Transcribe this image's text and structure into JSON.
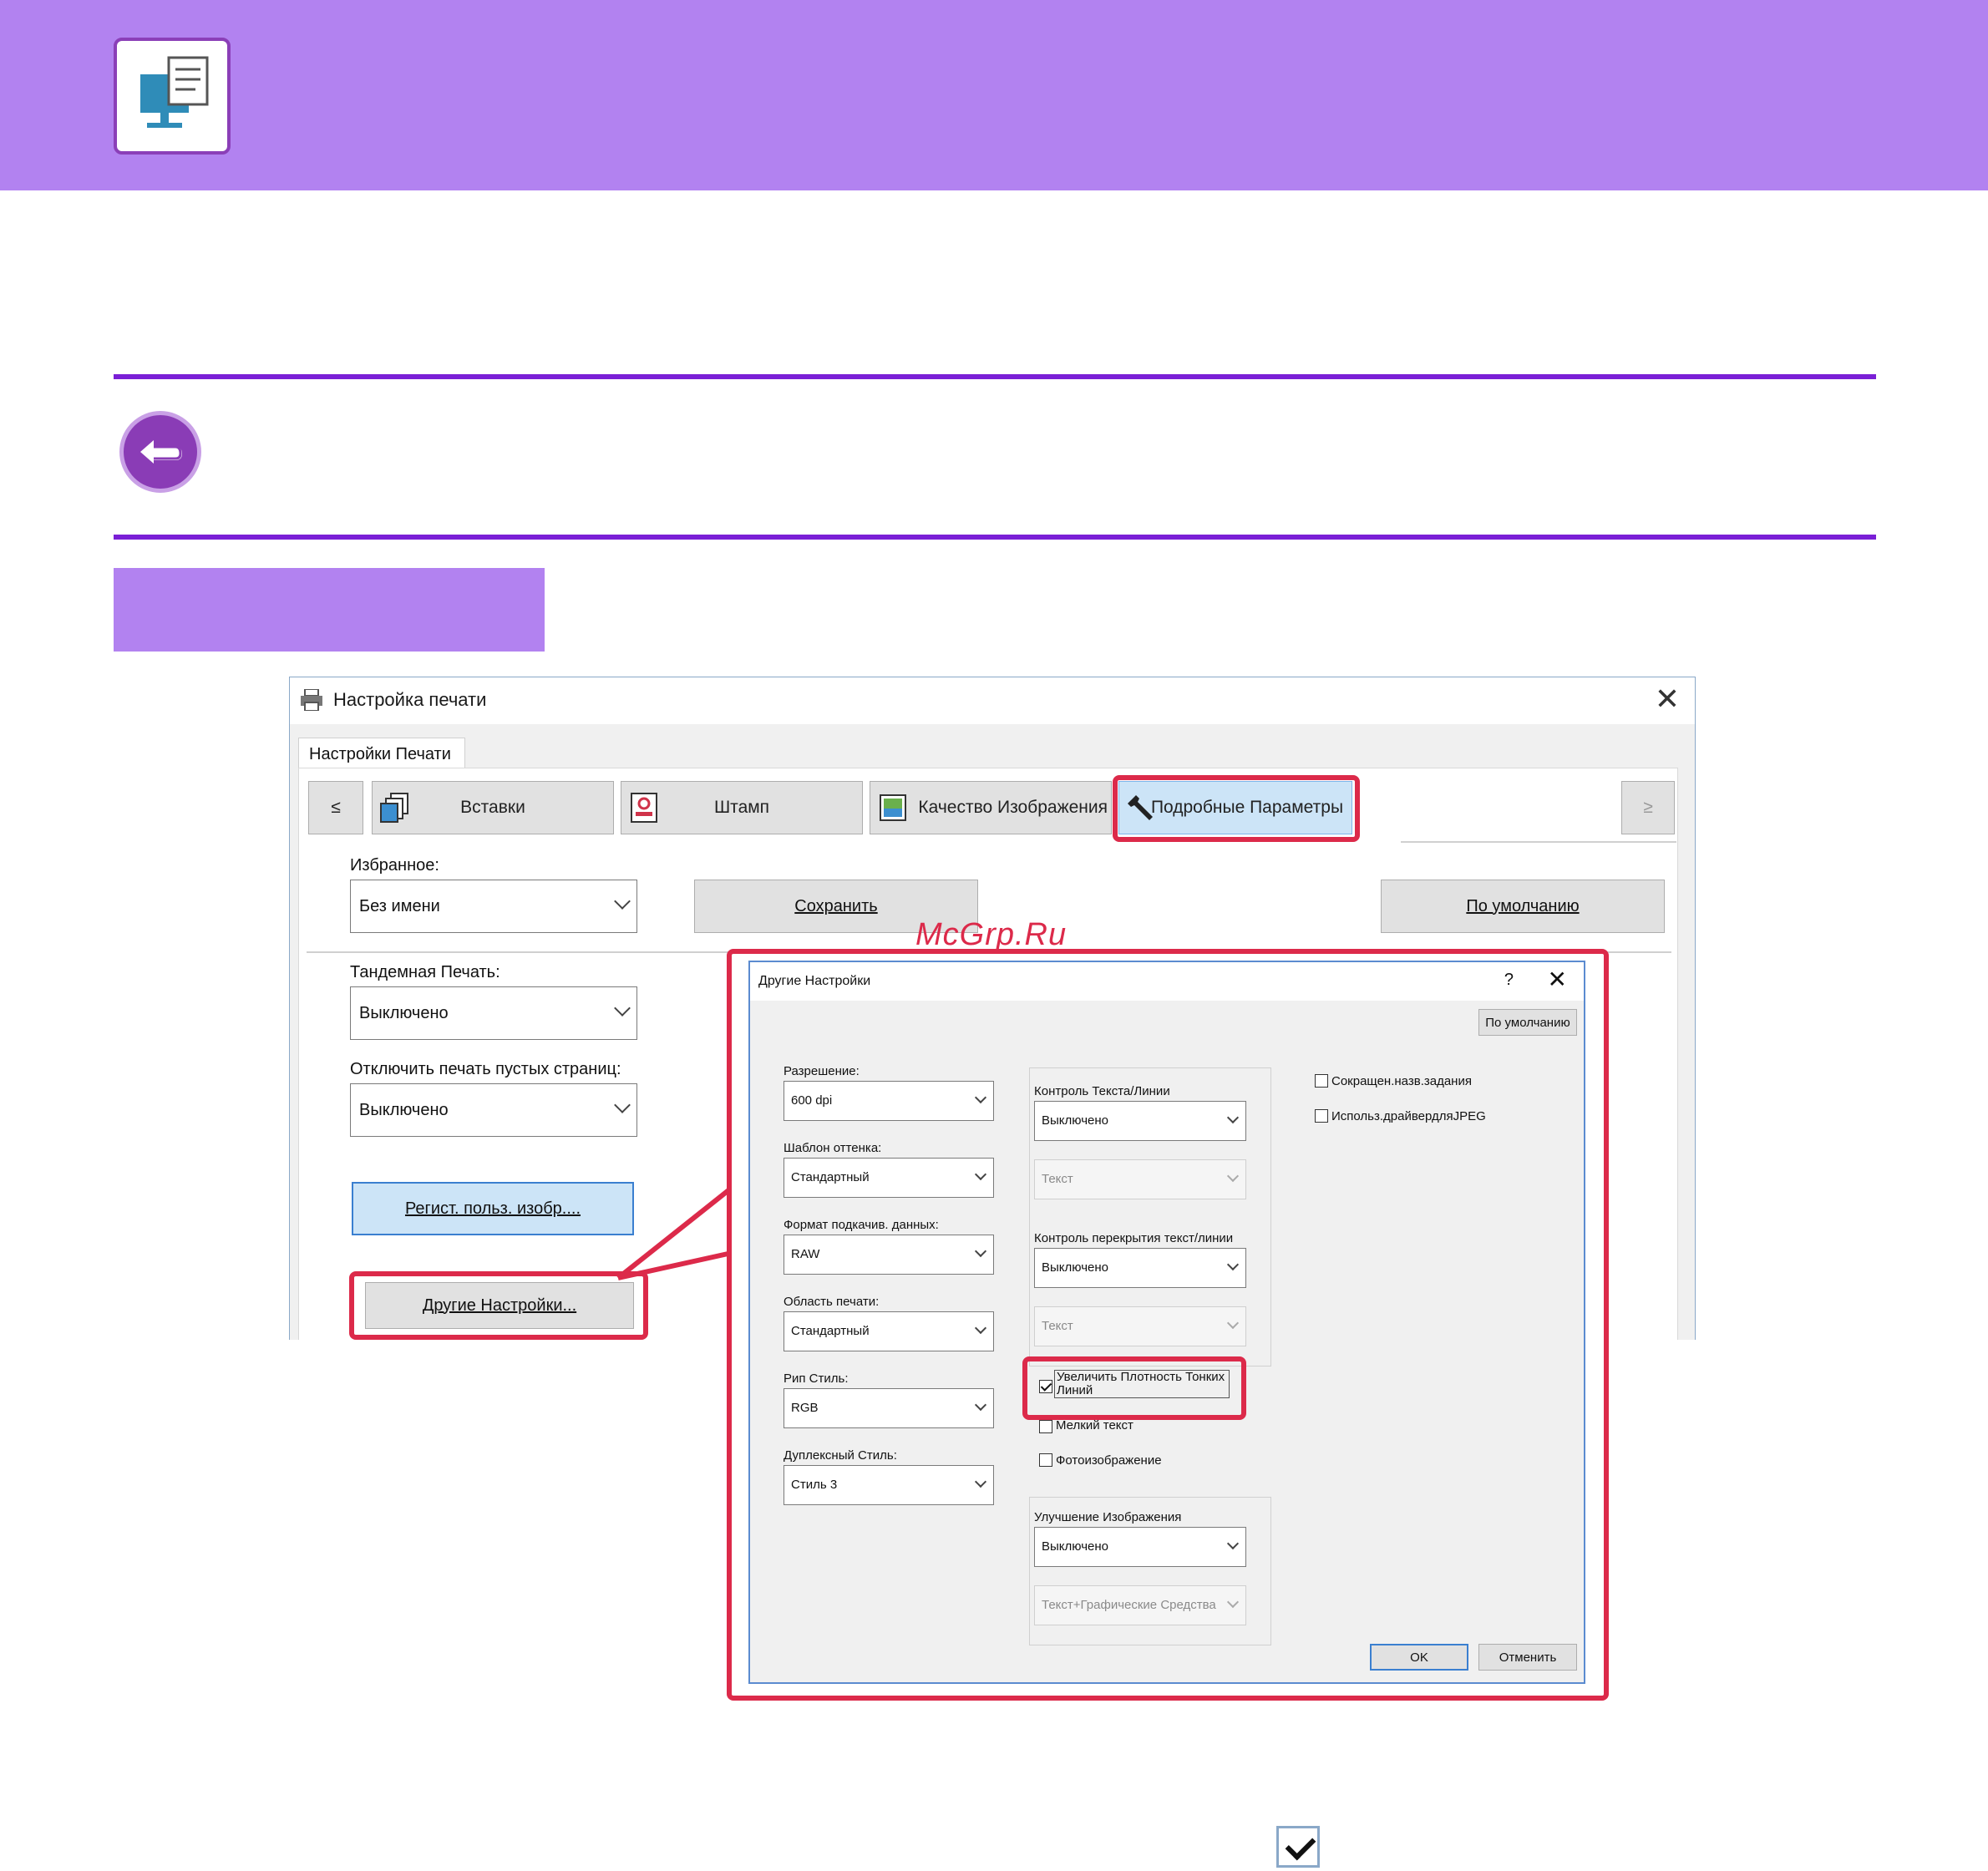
{
  "watermark": "McGrp.Ru",
  "dialog": {
    "title": "Настройка печати",
    "main_tab": "Настройки Печати",
    "tabs": [
      {
        "label": "≤"
      },
      {
        "label": "Вставки"
      },
      {
        "label": "Штамп"
      },
      {
        "label": "Качество Изображения"
      },
      {
        "label": "Подробные Параметры"
      },
      {
        "label": "≥"
      }
    ],
    "favorites_label": "Избранное:",
    "favorites_value": "Без имени",
    "save_button": "Сохранить",
    "default_button": "По умолчанию",
    "tandem_label": "Тандемная Печать:",
    "tandem_value": "Выключено",
    "blank_pages_label": "Отключить печать пустых страниц:",
    "blank_pages_value": "Выключено",
    "register_button": "Регист. польз. изобр....",
    "other_settings_button": "Другие Настройки..."
  },
  "popup": {
    "title": "Другие Настройки",
    "help": "?",
    "default_button": "По умолчанию",
    "resolution_label": "Разрешение:",
    "resolution_value": "600 dpi",
    "halftone_label": "Шаблон оттенка:",
    "halftone_value": "Стандартный",
    "spool_label": "Формат подкачив. данных:",
    "spool_value": "RAW",
    "print_area_label": "Область печати:",
    "print_area_value": "Стандартный",
    "rip_label": "Рип Стиль:",
    "rip_value": "RGB",
    "duplex_label": "Дуплексный Стиль:",
    "duplex_value": "Стиль 3",
    "text_line_label": "Контроль Текста/Линии",
    "text_line_value": "Выключено",
    "text_line_sub": "Текст",
    "overlap_label": "Контроль перекрытия текст/линии",
    "overlap_value": "Выключено",
    "overlap_sub": "Текст",
    "thin_lines_label": "Увеличить Плотность Тонких Линий",
    "small_text_label": "Мелкий текст",
    "photo_label": "Фотоизображение",
    "enhance_label": "Улучшение Изображения",
    "enhance_value": "Выключено",
    "enhance_sub": "Текст+Графические Средства",
    "short_job_label": "Сокращен.назв.задания",
    "jpeg_label": "Использ.драйвердляJPEG",
    "ok_button": "OK",
    "cancel_button": "Отменить"
  }
}
